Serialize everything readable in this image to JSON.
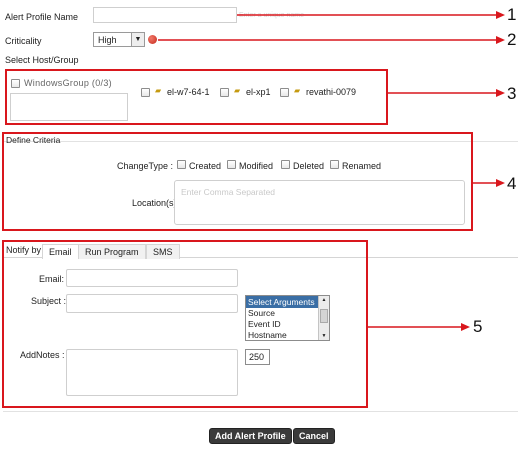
{
  "form": {
    "alert_profile_label": "Alert Profile Name",
    "alert_profile_placeholder": "Enter a unique name",
    "criticality_label": "Criticality",
    "criticality_value": "High",
    "select_host_label": "Select Host/Group"
  },
  "hosts": {
    "group_label": "WindowsGroup (0/3)",
    "items": [
      "el-w7-64-1",
      "el-xp1",
      "revathi-0079"
    ]
  },
  "criteria": {
    "section_title": "Define Criteria",
    "change_type_label": "ChangeType :",
    "change_types": [
      "Created",
      "Modified",
      "Deleted",
      "Renamed"
    ],
    "locations_label": "Location(s)",
    "locations_placeholder": "Enter Comma Separated"
  },
  "notify": {
    "notify_by_label": "Notify by",
    "tabs": [
      "Email",
      "Run Program",
      "SMS"
    ],
    "email_label": "Email:",
    "subject_label": "Subject :",
    "addnotes_label": "AddNotes :",
    "arguments": [
      "Select Arguments",
      "Source",
      "Event ID",
      "Hostname"
    ],
    "char_limit": "250"
  },
  "actions": {
    "add_label": "Add Alert Profile",
    "cancel_label": "Cancel"
  },
  "callouts": [
    "1",
    "2",
    "3",
    "4",
    "5"
  ],
  "colors": {
    "callout_red": "#d9171d",
    "button_dark": "#3a3a3a"
  }
}
